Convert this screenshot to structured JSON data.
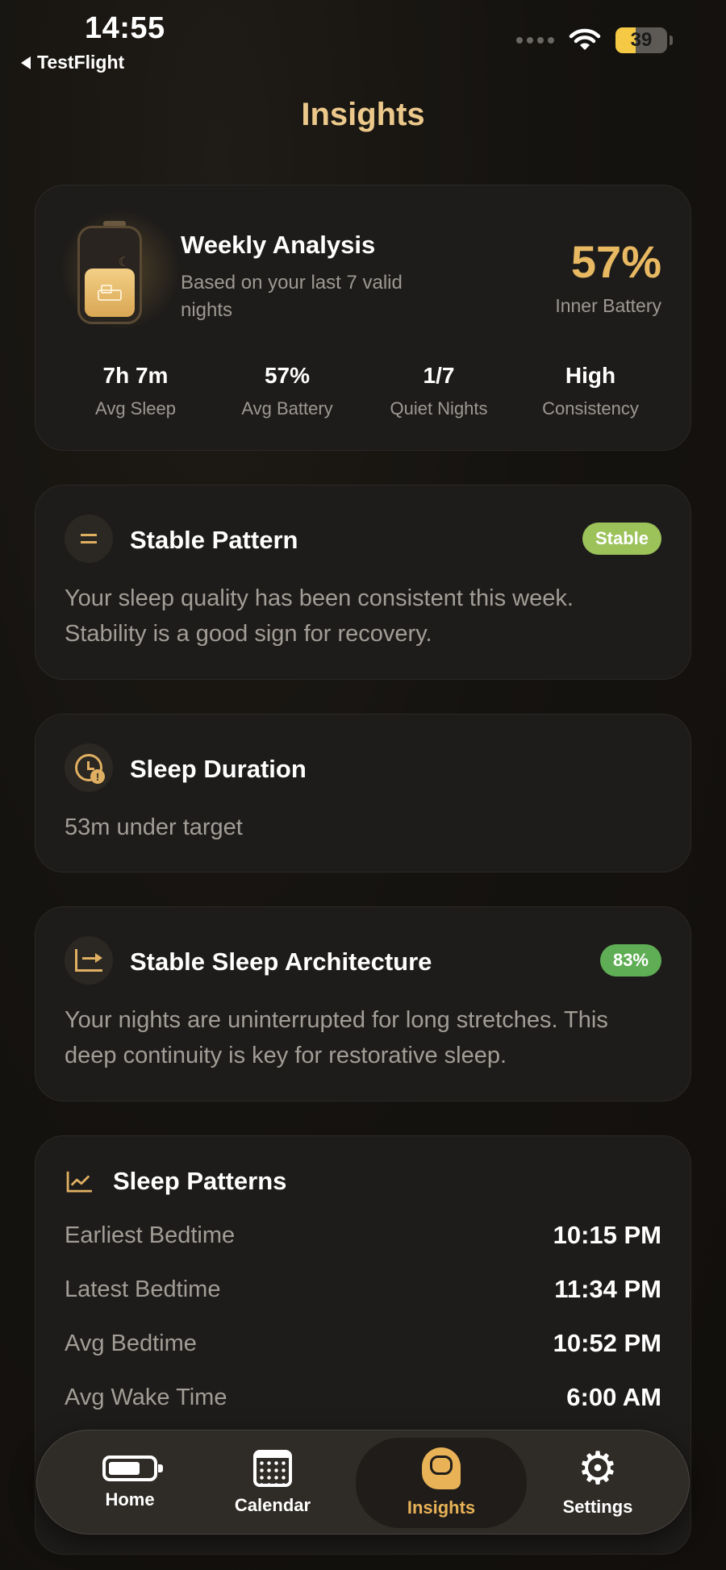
{
  "status_bar": {
    "time": "14:55",
    "back_label": "TestFlight",
    "battery": "39"
  },
  "page": {
    "title": "Insights"
  },
  "weekly": {
    "title": "Weekly Analysis",
    "subtitle": "Based on your last 7 valid nights",
    "percent": "57%",
    "percent_label": "Inner Battery",
    "stats": [
      {
        "value": "7h 7m",
        "label": "Avg Sleep"
      },
      {
        "value": "57%",
        "label": "Avg Battery"
      },
      {
        "value": "1/7",
        "label": "Quiet Nights"
      },
      {
        "value": "High",
        "label": "Consistency"
      }
    ]
  },
  "stable": {
    "title": "Stable Pattern",
    "badge": "Stable",
    "badge_color": "#9cc25a",
    "body": "Your sleep quality has been consistent this week. Stability is a good sign for recovery."
  },
  "duration": {
    "title": "Sleep Duration",
    "body": "53m under target"
  },
  "arch": {
    "title": "Stable Sleep Architecture",
    "badge": "83%",
    "badge_color": "#5fae55",
    "body": "Your nights are uninterrupted for long stretches. This deep continuity is key for restorative sleep."
  },
  "patterns": {
    "title": "Sleep Patterns",
    "rows": [
      {
        "label": "Earliest Bedtime",
        "value": "10:15 PM"
      },
      {
        "label": "Latest Bedtime",
        "value": "11:34 PM"
      },
      {
        "label": "Avg Bedtime",
        "value": "10:52 PM"
      },
      {
        "label": "Avg Wake Time",
        "value": "6:00 AM"
      }
    ]
  },
  "tabs": [
    {
      "label": "Home",
      "icon": "battery-icon"
    },
    {
      "label": "Calendar",
      "icon": "calendar-icon"
    },
    {
      "label": "Insights",
      "icon": "brain-head-icon",
      "active": true
    },
    {
      "label": "Settings",
      "icon": "gear-icon"
    }
  ],
  "accent_color": "#e8b962"
}
